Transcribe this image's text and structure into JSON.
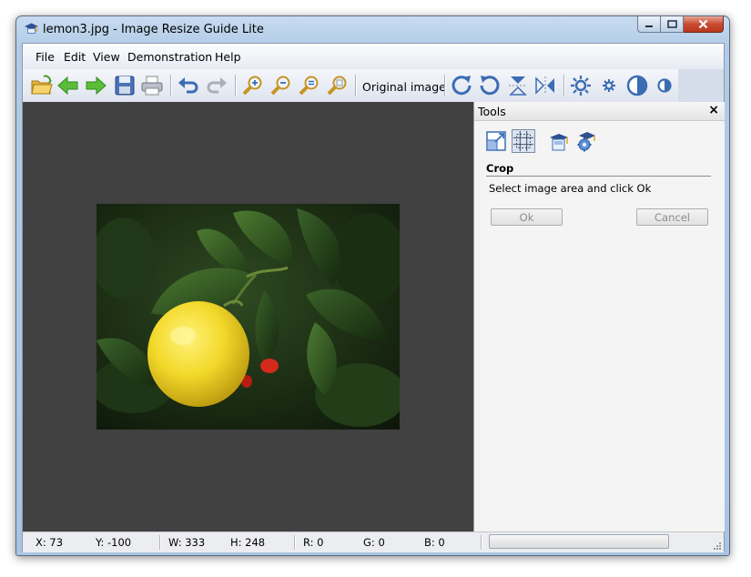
{
  "window": {
    "title": "lemon3.jpg - Image Resize Guide Lite",
    "app_icon": "graduation-cap-icon"
  },
  "menu": {
    "items": [
      "File",
      "Edit",
      "View",
      "Demonstration",
      "Help"
    ]
  },
  "toolbar": {
    "buttons": [
      {
        "name": "open-folder-icon"
      },
      {
        "name": "back-arrow-icon"
      },
      {
        "name": "forward-arrow-icon"
      },
      {
        "name": "save-icon"
      },
      {
        "name": "print-icon"
      },
      {
        "name": "undo-icon"
      },
      {
        "name": "redo-icon"
      },
      {
        "name": "zoom-in-icon"
      },
      {
        "name": "zoom-out-icon"
      },
      {
        "name": "zoom-fit-icon"
      },
      {
        "name": "zoom-actual-icon"
      },
      {
        "name": "rotate-clockwise-icon"
      },
      {
        "name": "rotate-counterclockwise-icon"
      },
      {
        "name": "flip-vertical-icon"
      },
      {
        "name": "flip-horizontal-icon"
      },
      {
        "name": "brightness-up-icon"
      },
      {
        "name": "brightness-down-icon"
      },
      {
        "name": "contrast-up-icon"
      },
      {
        "name": "contrast-down-icon"
      }
    ],
    "original_image_label": "Original image"
  },
  "tools_panel": {
    "title": "Tools",
    "close_glyph": "×",
    "tool_icons": [
      "resize-icon",
      "crop-icon",
      "demo-box-icon",
      "demo-gear-icon"
    ],
    "selected_tool": "crop-icon",
    "section_title": "Crop",
    "hint": "Select image area and click Ok",
    "ok_label": "Ok",
    "cancel_label": "Cancel"
  },
  "status": {
    "x": "X: 73",
    "y": "Y: -100",
    "w": "W: 333",
    "h": "H: 248",
    "r": "R: 0",
    "g": "G: 0",
    "b": "B: 0",
    "progress": 0
  },
  "colors": {
    "canvas_bg": "#414141",
    "titlebar": "#b2cbe7",
    "toolbar_icon_blue": "#3b6db4"
  }
}
